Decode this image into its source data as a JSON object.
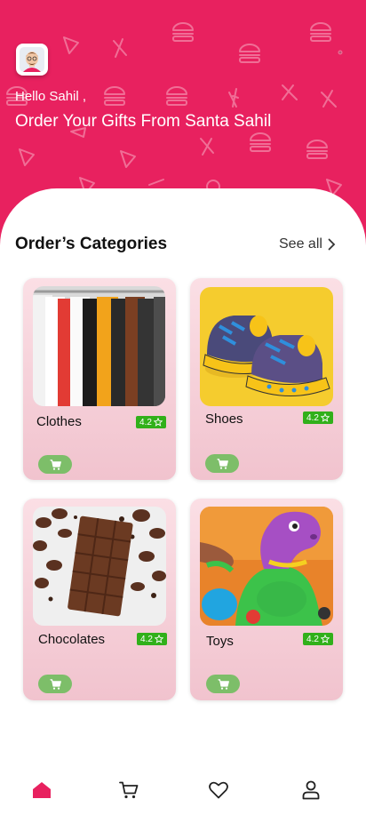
{
  "header": {
    "greeting": "Hello Sahil ,",
    "headline": "Order Your Gifts From Santa Sahil",
    "avatar_icon": "user-avatar-icon",
    "background_color": "#e8215f"
  },
  "categories_section": {
    "title": "Order’s Categories",
    "see_all_label": "See all"
  },
  "categories": [
    {
      "name": "Clothes",
      "rating": "4.2",
      "image": "clothes-rack-photo",
      "cart_icon": "cart-icon"
    },
    {
      "name": "Shoes",
      "rating": "4.2",
      "image": "toy-shoes-photo",
      "cart_icon": "cart-icon"
    },
    {
      "name": "Chocolates",
      "rating": "4.2",
      "image": "chocolate-bar-photo",
      "cart_icon": "cart-icon"
    },
    {
      "name": "Toys",
      "rating": "4.2",
      "image": "dinosaur-toy-photo",
      "cart_icon": "cart-icon"
    }
  ],
  "bottom_nav": {
    "items": [
      "home-icon",
      "cart-icon",
      "heart-icon",
      "user-icon"
    ],
    "active": "home-icon",
    "active_color": "#e8215f"
  },
  "colors": {
    "brand": "#e8215f",
    "rating_badge": "#31b01a",
    "cart_button": "#7dbe69"
  }
}
